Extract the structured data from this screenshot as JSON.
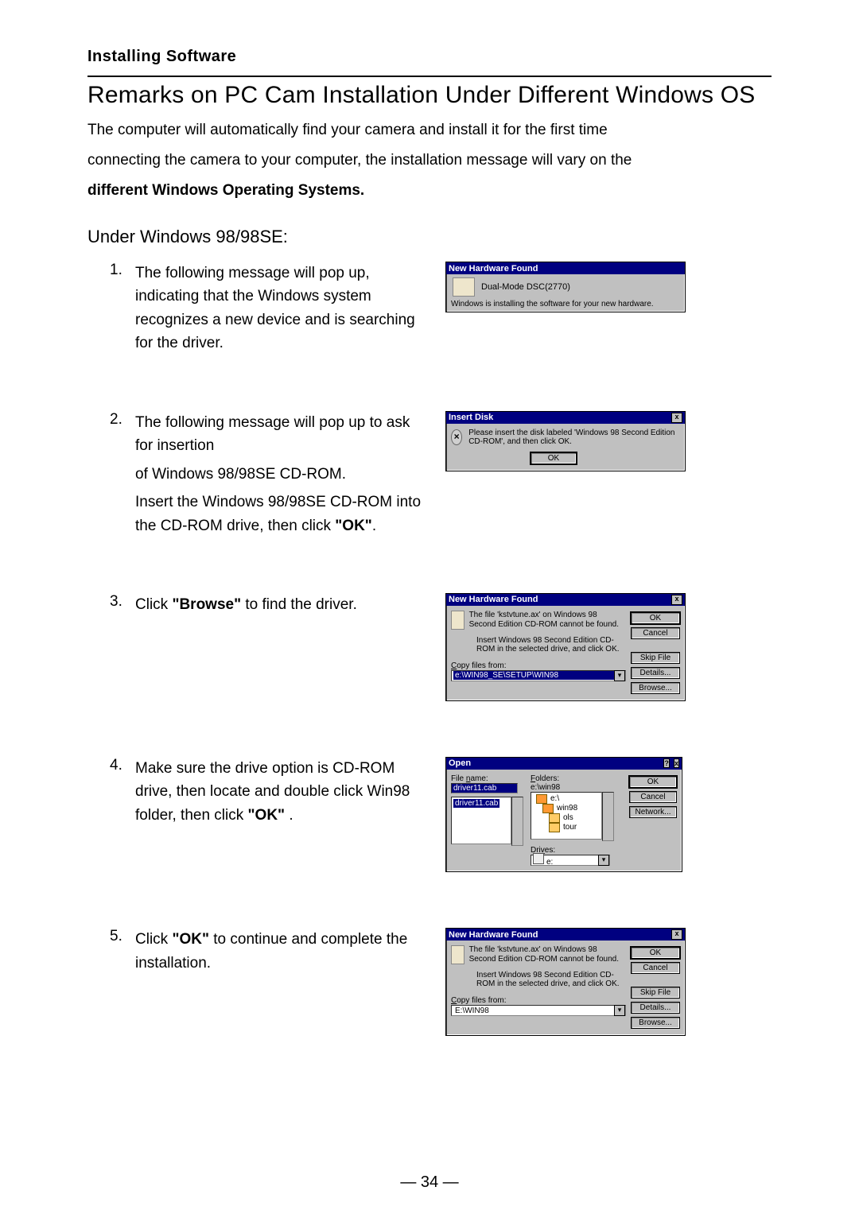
{
  "section_label": "Installing Software",
  "title": "Remarks on PC Cam Installation Under Different Windows OS",
  "intro_line1": "The computer will automatically find your camera and install it for the first time",
  "intro_line2": "connecting the camera to your computer, the installation message will vary on the",
  "intro_line3_bold": "different Windows Operating Systems.",
  "subhead": "Under Windows  98/98SE:",
  "steps": {
    "s1": {
      "num": "1.",
      "text": "The following message will pop up, indicating that the Windows system recognizes a new device and is searching for the driver."
    },
    "s2": {
      "num": "2.",
      "text": "The following message will pop up to ask for insertion",
      "sub1": "of Windows 98/98SE CD-ROM.",
      "sub2a": "Insert the Windows 98/98SE CD-ROM into the CD-ROM drive, then click ",
      "sub2b": "\"OK\"",
      "sub2c": "."
    },
    "s3": {
      "num": "3.",
      "pre": "Click ",
      "bold": "\"Browse\"",
      "post": " to find the driver."
    },
    "s4": {
      "num": "4.",
      "pre": "Make sure the drive option is CD-ROM drive, then locate and double click Win98 folder, then click ",
      "bold": "\"OK\"",
      "post": " ."
    },
    "s5": {
      "num": "5.",
      "pre": "Click ",
      "bold": "\"OK\"",
      "post": " to continue and complete the installation."
    }
  },
  "dlg1": {
    "title": "New Hardware Found",
    "device": "Dual-Mode DSC(2770)",
    "status": "Windows is installing the software for your new hardware."
  },
  "dlg2": {
    "title": "Insert Disk",
    "msg": "Please insert the disk labeled 'Windows 98 Second Edition CD-ROM', and then click OK.",
    "ok": "OK",
    "close": "x"
  },
  "dlg_nhf": {
    "title": "New Hardware Found",
    "msg": "The file 'kstvtune.ax' on Windows 98 Second Edition CD-ROM cannot be found.",
    "hint": "Insert Windows 98 Second Edition CD-ROM in the selected drive, and click OK.",
    "copy_label": "Copy files from:",
    "ok": "OK",
    "cancel": "Cancel",
    "skip": "Skip File",
    "details": "Details...",
    "browse": "Browse...",
    "path3": "e:\\WIN98_SE\\SETUP\\WIN98",
    "path5": "E:\\WIN98",
    "close": "x"
  },
  "dlg_open": {
    "title": "Open",
    "file_name_label": "File name:",
    "file_name_value": "driver11.cab",
    "list_entry": "driver11.cab",
    "folders_label": "Folders:",
    "folders_path": "e:\\win98",
    "folder_root": "e:\\",
    "folder_win98": "win98",
    "folder_ols": "ols",
    "folder_tour": "tour",
    "drives_label": "Drives:",
    "drives_value": "e:",
    "ok": "OK",
    "cancel": "Cancel",
    "network": "Network...",
    "help": "?",
    "close": "x"
  },
  "page_number": "— 34 —"
}
